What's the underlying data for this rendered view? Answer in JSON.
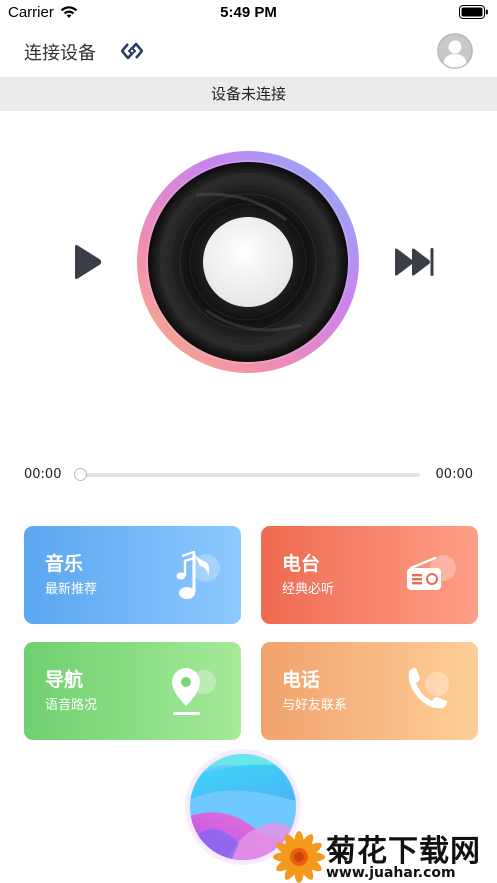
{
  "status_bar": {
    "carrier": "Carrier",
    "time": "5:49 PM"
  },
  "nav": {
    "title": "连接设备"
  },
  "connection": {
    "status": "设备未连接"
  },
  "player": {
    "current_time": "00:00",
    "total_time": "00:00",
    "progress": 0
  },
  "cards": [
    {
      "title": "音乐",
      "subtitle": "最新推荐",
      "icon": "music-note-icon"
    },
    {
      "title": "电台",
      "subtitle": "经典必听",
      "icon": "radio-icon"
    },
    {
      "title": "导航",
      "subtitle": "语音路况",
      "icon": "map-pin-icon"
    },
    {
      "title": "电话",
      "subtitle": "与好友联系",
      "icon": "phone-icon"
    }
  ],
  "watermark": {
    "title": "菊花下载网",
    "url": "www.juahar.com"
  },
  "colors": {
    "music": "#5aa6f0",
    "radio": "#ee6a50",
    "navigation": "#6fd06f",
    "phone": "#f1a26c"
  }
}
